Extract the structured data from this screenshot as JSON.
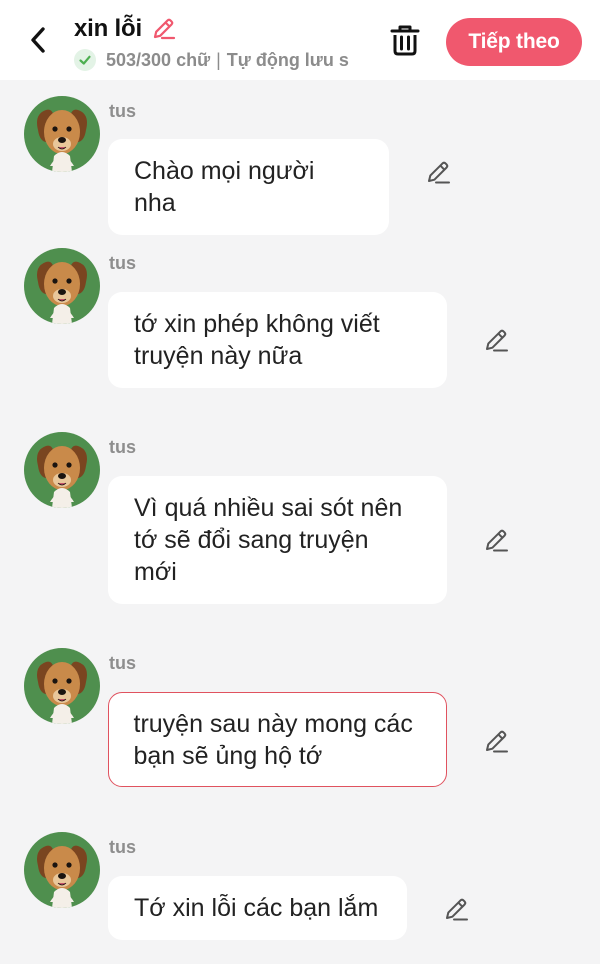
{
  "header": {
    "title": "xin lỗi",
    "word_count": "503/300 chữ",
    "separator": "|",
    "autosave": "Tự động lưu s",
    "next_label": "Tiếp theo",
    "colors": {
      "accent": "#f0586e",
      "check": "#4caf50"
    }
  },
  "icons": {
    "back": "chevron-left-icon",
    "edit": "pencil-icon",
    "trash": "trash-icon",
    "check": "check-circle-icon",
    "avatar": "dog-avatar"
  },
  "messages": [
    {
      "author": "tus",
      "lines": [
        "Chào mọi người nha"
      ],
      "selected": false
    },
    {
      "author": "tus",
      "lines": [
        "tớ xin phép không viết",
        "truyện này nữa"
      ],
      "selected": false
    },
    {
      "author": "tus",
      "lines": [
        "Vì quá nhiều sai sót nên",
        "tớ sẽ đổi sang truyện",
        "mới"
      ],
      "selected": false
    },
    {
      "author": "tus",
      "lines": [
        "truyện sau này mong các",
        "bạn sẽ ủng hộ tớ"
      ],
      "selected": true
    },
    {
      "author": "tus",
      "lines": [
        "Tớ xin lỗi các bạn lắm"
      ],
      "selected": false
    }
  ]
}
